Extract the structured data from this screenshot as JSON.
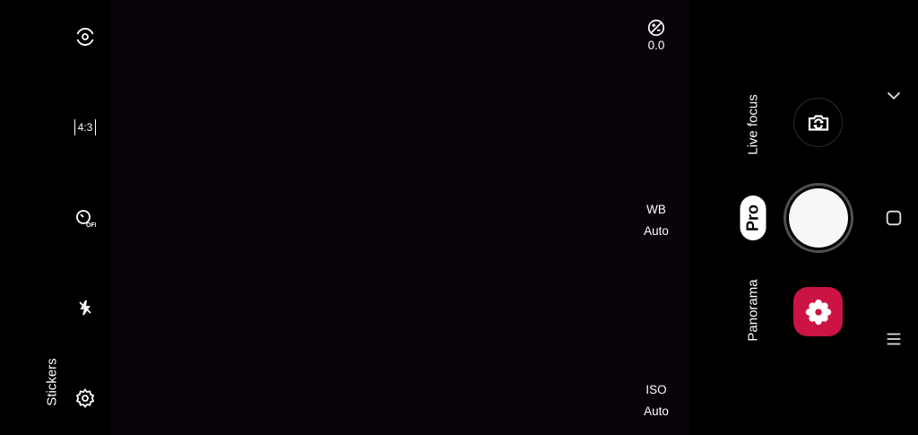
{
  "left_toolbar": {
    "aspect_ratio_label": "4:3",
    "stickers_label": "Stickers"
  },
  "settings": {
    "exposure_value": "0.0",
    "wb_label": "WB",
    "wb_value": "Auto",
    "iso_label": "ISO",
    "iso_value": "Auto"
  },
  "modes": {
    "live_focus": "Live focus",
    "pro": "Pro",
    "panorama": "Panorama"
  },
  "colors": {
    "gallery_accent": "#cc1444",
    "viewfinder_bg": "#070308"
  }
}
